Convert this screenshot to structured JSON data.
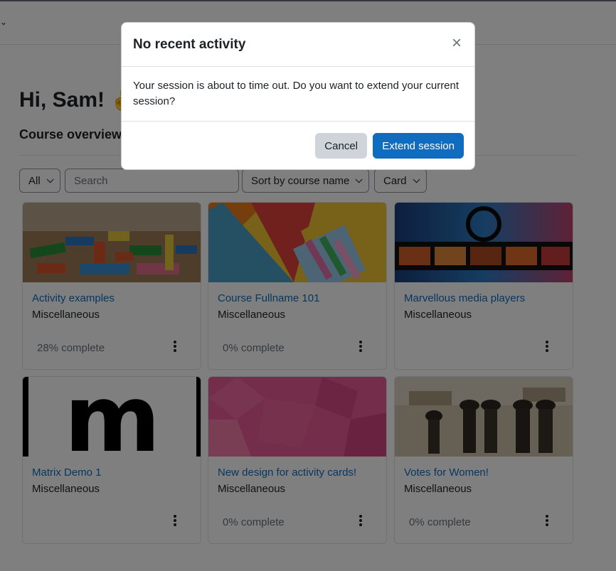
{
  "page": {
    "greeting": "Hi, Sam!",
    "greeting_icon": "waving-hand-icon",
    "overview_title": "Course overview"
  },
  "filters": {
    "grouping": "All",
    "search_placeholder": "Search",
    "sort": "Sort by course name",
    "view": "Card"
  },
  "courses": [
    {
      "name": "Activity examples",
      "category": "Miscellaneous",
      "progress": "28% complete",
      "progress_value": 28,
      "image": "toy-blocks"
    },
    {
      "name": "Course Fullname 101",
      "category": "Miscellaneous",
      "progress": "0% complete",
      "progress_value": 0,
      "image": "stationery"
    },
    {
      "name": "Marvellous media players",
      "category": "Miscellaneous",
      "progress": "",
      "image": "film-strip"
    },
    {
      "name": "Matrix Demo 1",
      "category": "Miscellaneous",
      "progress": "",
      "image": "m-logo",
      "image_text": "m"
    },
    {
      "name": "New design for activity cards!",
      "category": "Miscellaneous",
      "progress": "0% complete",
      "progress_value": 0,
      "image": "pink-pattern"
    },
    {
      "name": "Votes for Women!",
      "category": "Miscellaneous",
      "progress": "0% complete",
      "progress_value": 0,
      "image": "historic-photo"
    }
  ],
  "modal": {
    "title": "No recent activity",
    "message": "Your session is about to time out. Do you want to extend your current session?",
    "cancel_label": "Cancel",
    "extend_label": "Extend session",
    "close_icon": "close-icon"
  },
  "colors": {
    "link": "#0f6cbf",
    "primary_button": "#0f6cbf",
    "secondary_button": "#ced4da",
    "text": "#1d2125",
    "muted": "#6a737b",
    "overlay": "rgba(0,0,0,0.5)"
  }
}
